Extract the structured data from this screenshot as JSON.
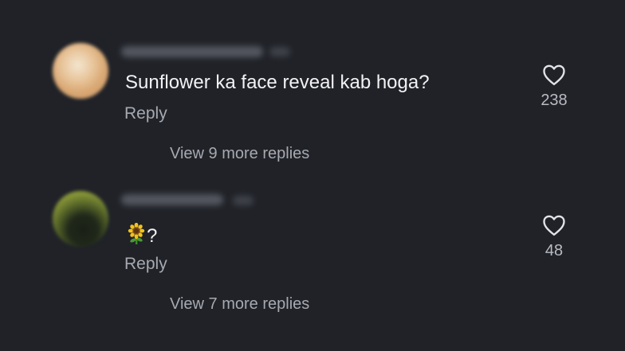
{
  "comments": [
    {
      "text": "Sunflower ka face reveal kab hoga?",
      "reply_label": "Reply",
      "like_count": "238",
      "view_replies_label": "View 9 more replies",
      "avatar_icon": "blurred-avatar"
    },
    {
      "emoji_icon": "sunflower-emoji",
      "text": "?",
      "reply_label": "Reply",
      "like_count": "48",
      "view_replies_label": "View 7 more replies",
      "avatar_icon": "blurred-avatar"
    }
  ],
  "icons": {
    "like": "heart-outline-icon"
  },
  "colors": {
    "background": "#202228",
    "primary_text": "#f2f2f4",
    "secondary_text": "#a7a9b1"
  }
}
